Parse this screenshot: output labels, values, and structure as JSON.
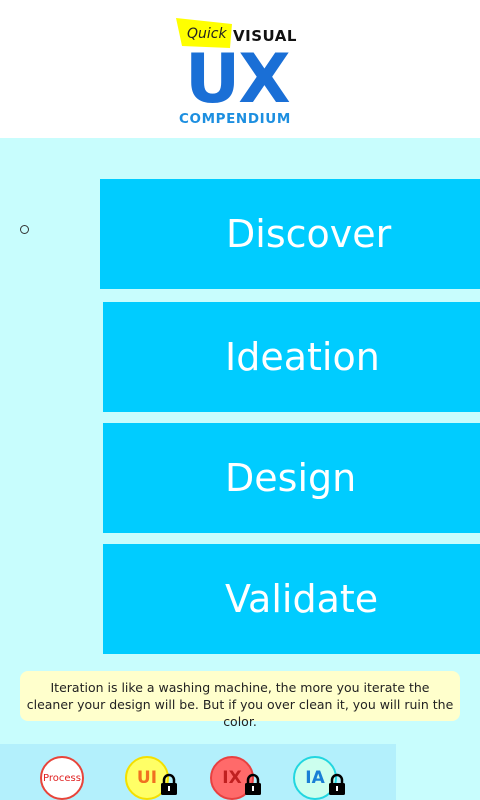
{
  "logo": {
    "quick": "Quick",
    "visual": "VISUAL",
    "ux": "UX",
    "compendium": "COMPENDIUM"
  },
  "stages": [
    {
      "label": "Discover"
    },
    {
      "label": "Ideation"
    },
    {
      "label": "Design"
    },
    {
      "label": "Validate"
    }
  ],
  "quote": "Iteration is like a washing machine, the more you iterate the cleaner your design will be. But if you over clean it, you will ruin the color.",
  "nav": {
    "process": "Process",
    "ui": "UI",
    "ix": "IX",
    "ia": "IA"
  },
  "colors": {
    "header_bg": "#ffffff",
    "page_bg": "#c8fdfd",
    "stage_bg": "#00ccff",
    "quote_bg": "#ffffcc",
    "bottom_bar_bg": "#b3f0fc",
    "ux_blue": "#1a6fd6"
  },
  "icons": {
    "locked_indicator": "lock-icon"
  }
}
